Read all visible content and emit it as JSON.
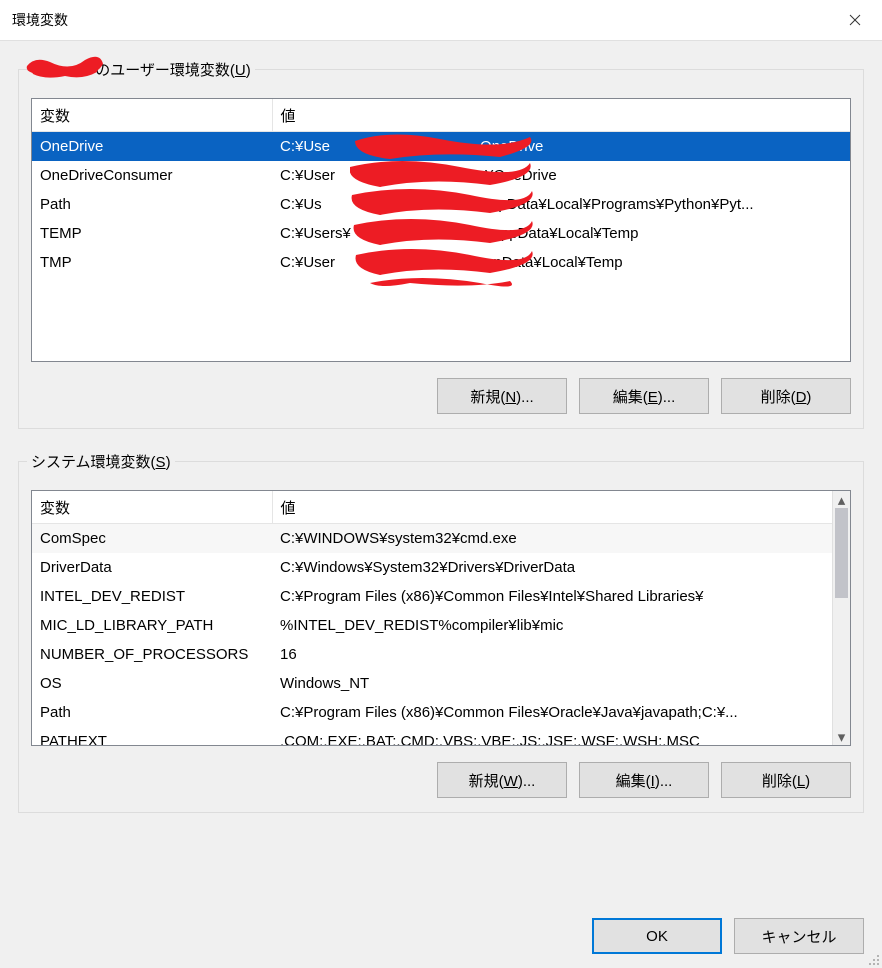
{
  "window": {
    "title": "環境変数"
  },
  "user_section": {
    "legend_suffix": "のユーザー環境変数(",
    "legend_accel": "U",
    "legend_close": ")"
  },
  "columns": {
    "var": "変数",
    "val": "値"
  },
  "user_vars": [
    {
      "name": "OneDrive",
      "value_left": "C:¥Use",
      "value_right": "OneDrive"
    },
    {
      "name": "OneDriveConsumer",
      "value_left": "C:¥User",
      "value_right": "¥OneDrive"
    },
    {
      "name": "Path",
      "value_left": "C:¥Us",
      "value_right": "¥AppData¥Local¥Programs¥Python¥Pyt..."
    },
    {
      "name": "TEMP",
      "value_left": "C:¥Users¥",
      "value_right": "ppData¥Local¥Temp"
    },
    {
      "name": "TMP",
      "value_left": "C:¥User",
      "value_right": "ppData¥Local¥Temp"
    }
  ],
  "system_section": {
    "legend": "システム環境変数(",
    "legend_accel": "S",
    "legend_close": ")"
  },
  "system_vars": [
    {
      "name": "ComSpec",
      "value": "C:¥WINDOWS¥system32¥cmd.exe"
    },
    {
      "name": "DriverData",
      "value": "C:¥Windows¥System32¥Drivers¥DriverData"
    },
    {
      "name": "INTEL_DEV_REDIST",
      "value": "C:¥Program Files (x86)¥Common Files¥Intel¥Shared Libraries¥"
    },
    {
      "name": "MIC_LD_LIBRARY_PATH",
      "value": "%INTEL_DEV_REDIST%compiler¥lib¥mic"
    },
    {
      "name": "NUMBER_OF_PROCESSORS",
      "value": "16"
    },
    {
      "name": "OS",
      "value": "Windows_NT"
    },
    {
      "name": "Path",
      "value": "C:¥Program Files (x86)¥Common Files¥Oracle¥Java¥javapath;C:¥..."
    },
    {
      "name": "PATHEXT",
      "value": ".COM;.EXE;.BAT;.CMD;.VBS;.VBE;.JS;.JSE;.WSF;.WSH;.MSC"
    }
  ],
  "buttons": {
    "user_new": {
      "label": "新規(",
      "accel": "N",
      "suffix": ")..."
    },
    "user_edit": {
      "label": "編集(",
      "accel": "E",
      "suffix": ")..."
    },
    "user_del": {
      "label": "削除(",
      "accel": "D",
      "suffix": ")"
    },
    "sys_new": {
      "label": "新規(",
      "accel": "W",
      "suffix": ")..."
    },
    "sys_edit": {
      "label": "編集(",
      "accel": "I",
      "suffix": ")..."
    },
    "sys_del": {
      "label": "削除(",
      "accel": "L",
      "suffix": ")"
    },
    "ok": "OK",
    "cancel": "キャンセル"
  }
}
